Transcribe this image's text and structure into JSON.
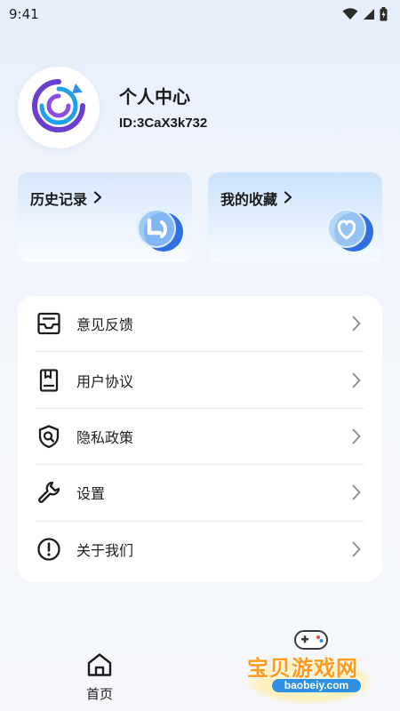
{
  "status_bar": {
    "time": "9:41",
    "icons": [
      "wifi-icon",
      "signal-icon",
      "battery-icon"
    ]
  },
  "profile": {
    "title": "个人中心",
    "id_text": "ID:3CaX3k732",
    "avatar_icon": "circular-refresh-logo-icon"
  },
  "quick_cards": [
    {
      "label": "历史记录",
      "icon": "clock-history-icon"
    },
    {
      "label": "我的收藏",
      "icon": "heart-favorite-icon"
    }
  ],
  "menu": {
    "items": [
      {
        "label": "意见反馈",
        "icon": "inbox-feedback-icon"
      },
      {
        "label": "用户协议",
        "icon": "document-icon"
      },
      {
        "label": "隐私政策",
        "icon": "shield-search-icon"
      },
      {
        "label": "设置",
        "icon": "wrench-icon"
      },
      {
        "label": "关于我们",
        "icon": "exclamation-circle-icon"
      }
    ]
  },
  "bottom_nav": {
    "home_label": "首页",
    "home_icon": "home-icon"
  },
  "watermark": {
    "text": "宝贝游戏网",
    "url": "baobeiy.com"
  },
  "colors": {
    "accent_blue": "#2f7cf0",
    "avatar_purple": "#6a3fd0",
    "watermark_orange": "#ff9a1f"
  }
}
